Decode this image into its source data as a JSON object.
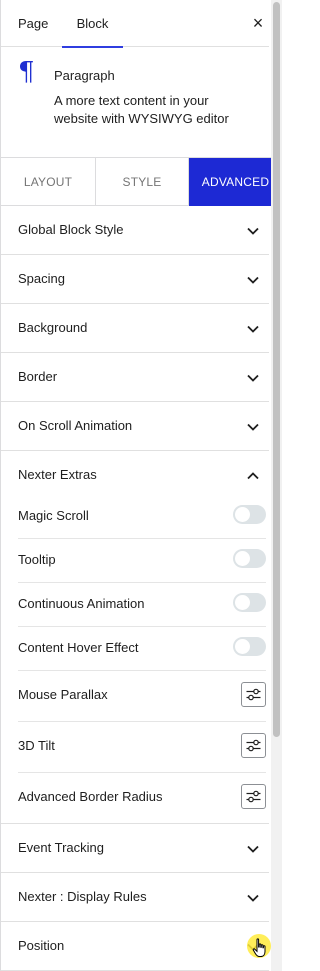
{
  "header": {
    "tabs": [
      {
        "label": "Page"
      },
      {
        "label": "Block"
      }
    ],
    "close_icon": "×"
  },
  "block": {
    "icon": "¶",
    "name": "Paragraph",
    "description": "A more text content in your website with WYSIWYG editor"
  },
  "section_tabs": {
    "layout": "LAYOUT",
    "style": "STYLE",
    "advanced": "ADVANCED",
    "active": "ADVANCED"
  },
  "panels": {
    "global_block_style": "Global Block Style",
    "spacing": "Spacing",
    "background": "Background",
    "border": "Border",
    "on_scroll_animation": "On Scroll Animation",
    "nexter_extras": "Nexter Extras",
    "event_tracking": "Event Tracking",
    "display_rules": "Nexter : Display Rules",
    "position": "Position"
  },
  "extras": {
    "magic_scroll": "Magic Scroll",
    "tooltip": "Tooltip",
    "continuous_animation": "Continuous Animation",
    "content_hover_effect": "Content Hover Effect",
    "mouse_parallax": "Mouse Parallax",
    "tilt_3d": "3D Tilt",
    "advanced_border_radius": "Advanced Border Radius"
  },
  "colors": {
    "accent": "#1d29d4",
    "toggle_off": "#dde3e6"
  }
}
